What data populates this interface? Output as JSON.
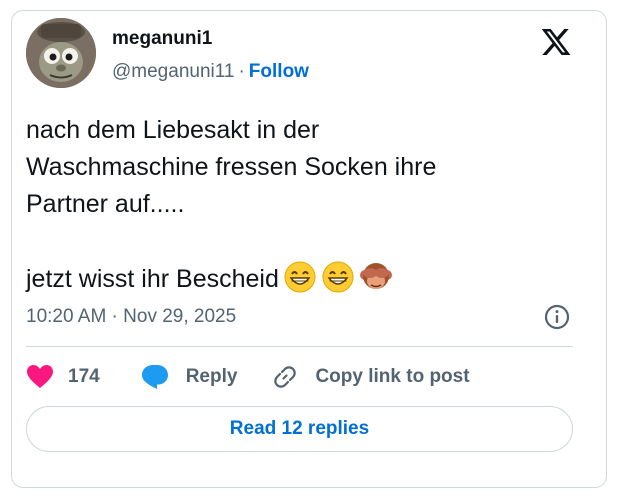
{
  "author": {
    "display_name": "meganuni1",
    "handle": "@meganuni11",
    "separator": "·",
    "follow_label": "Follow",
    "avatar_icon": "cartoon-character-avatar"
  },
  "brand": {
    "logo_icon": "x-logo-icon"
  },
  "tweet": {
    "lines": [
      "nach dem Liebesakt in der",
      "Waschmaschine fressen Socken ihre",
      "Partner auf.....",
      "jetzt wisst ihr Bescheid"
    ],
    "emojis": [
      "grinning-face-with-smiling-eyes",
      "grinning-face-with-smiling-eyes",
      "see-no-evil-monkey"
    ],
    "timestamp": "10:20 AM · Nov 29, 2025"
  },
  "actions": {
    "like_count": "174",
    "reply_label": "Reply",
    "copy_label": "Copy link to post"
  },
  "footer": {
    "read_replies_label": "Read 12 replies"
  },
  "colors": {
    "like": "#f91880",
    "reply": "#1d9bf0",
    "link": "#006fd6",
    "muted": "#536471",
    "border": "#cfd9de"
  }
}
